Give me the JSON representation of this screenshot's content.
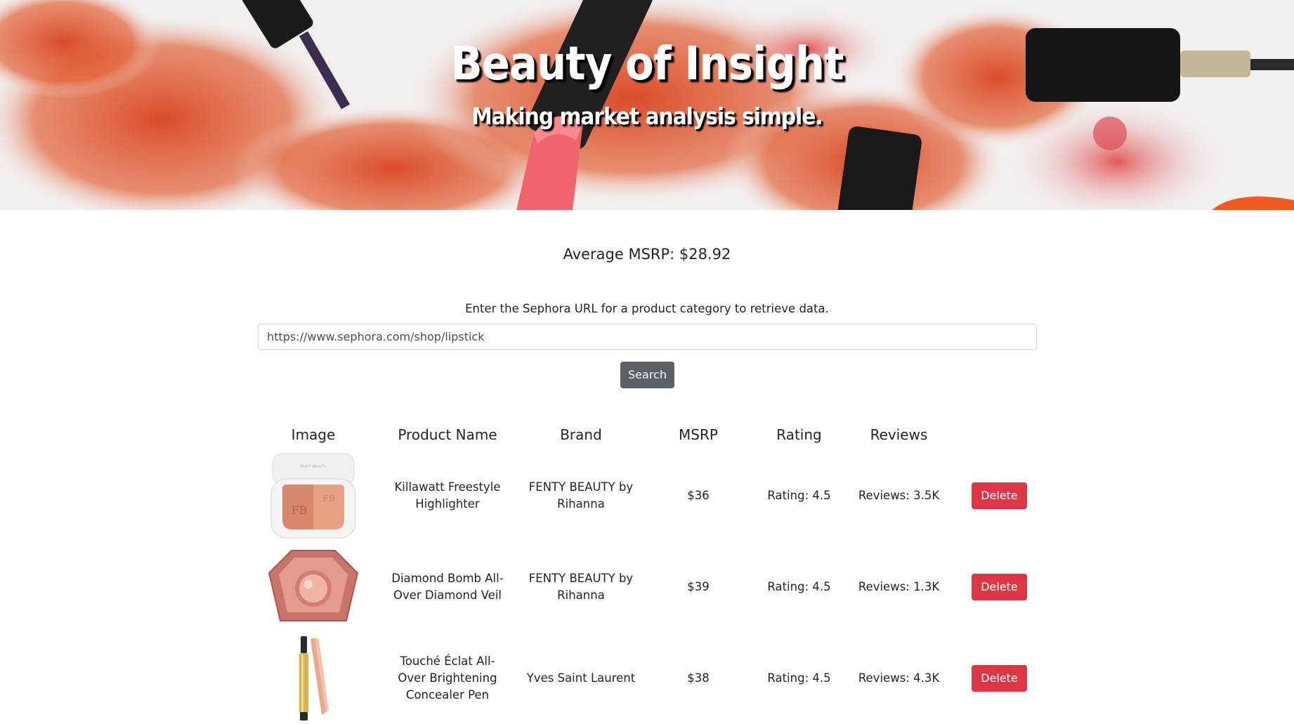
{
  "header": {
    "title": "Beauty of Insight",
    "subtitle": "Making market analysis simple."
  },
  "summary": {
    "average_msrp": "Average MSRP: $28.92"
  },
  "search": {
    "instructions": "Enter the Sephora URL for a product category to retrieve data.",
    "url_value": "https://www.sephora.com/shop/lipstick",
    "button_label": "Search"
  },
  "table": {
    "headers": [
      "Image",
      "Product Name",
      "Brand",
      "MSRP",
      "Rating",
      "Reviews",
      ""
    ],
    "rows": [
      {
        "image": "highlighter-compact-image",
        "name_lines": [
          "Killawatt Freestyle",
          "Highlighter"
        ],
        "brand_lines": [
          "FENTY BEAUTY by",
          "Rihanna"
        ],
        "msrp": "$36",
        "rating": "Rating: 4.5",
        "reviews": "Reviews: 3.5K",
        "delete_label": "Delete"
      },
      {
        "image": "diamond-compact-image",
        "name_lines": [
          "Diamond Bomb All-",
          "Over Diamond Veil"
        ],
        "brand_lines": [
          "FENTY BEAUTY by",
          "Rihanna"
        ],
        "msrp": "$39",
        "rating": "Rating: 4.5",
        "reviews": "Reviews: 1.3K",
        "delete_label": "Delete"
      },
      {
        "image": "concealer-pen-image",
        "name_lines": [
          "Touché Éclat All-",
          "Over Brightening",
          "Concealer Pen"
        ],
        "brand_lines": [
          "Yves Saint Laurent"
        ],
        "msrp": "$38",
        "rating": "Rating: 4.5",
        "reviews": "Reviews: 4.3K",
        "delete_label": "Delete"
      }
    ]
  },
  "colors": {
    "delete": "#dc3545",
    "search_button": "#5a6268",
    "hero_powder": "#e0582f"
  }
}
